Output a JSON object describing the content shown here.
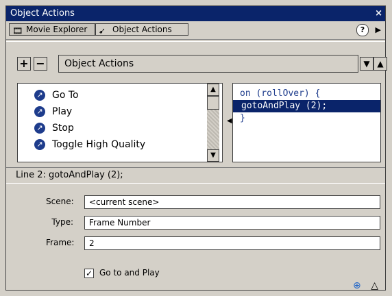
{
  "window": {
    "title": "Object Actions",
    "close_glyph": "×"
  },
  "tabs": [
    {
      "label": "Movie Explorer",
      "icon": "movie-explorer-icon",
      "state": "inactive"
    },
    {
      "label": "Object Actions",
      "icon": "object-actions-icon",
      "state": "active"
    }
  ],
  "toolbar": {
    "add_glyph": "+",
    "remove_glyph": "−",
    "title": "Object Actions",
    "down_glyph": "▼",
    "up_glyph": "▲"
  },
  "actions_list": [
    {
      "label": "Go To",
      "icon": "action-icon"
    },
    {
      "label": "Play",
      "icon": "action-icon"
    },
    {
      "label": "Stop",
      "icon": "action-icon"
    },
    {
      "label": "Toggle High Quality",
      "icon": "action-icon"
    }
  ],
  "code_lines": [
    {
      "text": "on (rollOver) {"
    },
    {
      "text": "gotoAndPlay (2);",
      "selected": true
    },
    {
      "text": "}"
    }
  ],
  "status": {
    "text": "Line 2: gotoAndPlay (2);"
  },
  "params": {
    "scene_label": "Scene:",
    "scene_value": "<current scene>",
    "type_label": "Type:",
    "type_value": "Frame Number",
    "frame_label": "Frame:",
    "frame_value": "2",
    "checkbox_label": "Go to and Play",
    "checkbox_checked": true
  },
  "colors": {
    "titlebar": "#0a246a",
    "selection": "#0a246a",
    "code_text": "#1e3c8c"
  }
}
